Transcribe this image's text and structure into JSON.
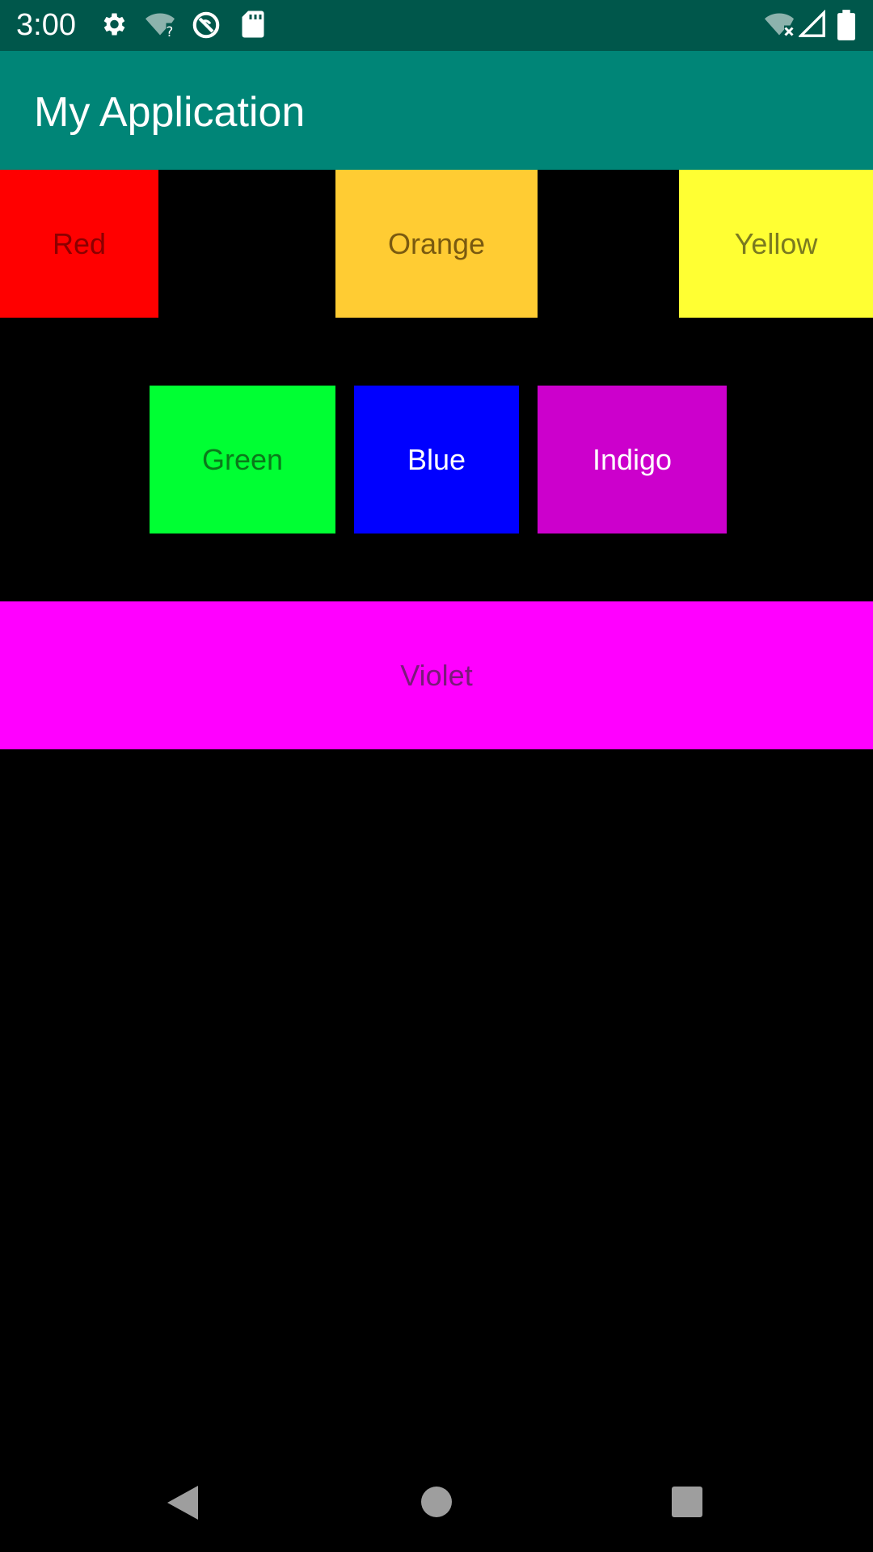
{
  "status_bar": {
    "time": "3:00",
    "icons": [
      "settings-icon",
      "wifi-unknown-icon",
      "sync-blocked-icon",
      "sd-card-icon",
      "wifi-off-icon",
      "signal-icon",
      "battery-icon"
    ],
    "color": "#00574B"
  },
  "app_bar": {
    "title": "My Application",
    "color": "#008577"
  },
  "tiles": [
    {
      "label": "Red",
      "color": "#FF0000",
      "text_color": "#8B0000"
    },
    {
      "label": "Orange",
      "color": "#FFCC33",
      "text_color": "#7A5A10"
    },
    {
      "label": "Yellow",
      "color": "#FFFF33",
      "text_color": "#7A7A20"
    },
    {
      "label": "Green",
      "color": "#00FF33",
      "text_color": "#0A7A1A"
    },
    {
      "label": "Blue",
      "color": "#0000FF",
      "text_color": "#FFFFFF"
    },
    {
      "label": "Indigo",
      "color": "#CC00CC",
      "text_color": "#FFFFFF"
    },
    {
      "label": "Violet",
      "color": "#FF00FF",
      "text_color": "#7A1A7A"
    }
  ],
  "nav_bar": {
    "buttons": [
      "back-icon",
      "home-icon",
      "recents-icon"
    ]
  }
}
